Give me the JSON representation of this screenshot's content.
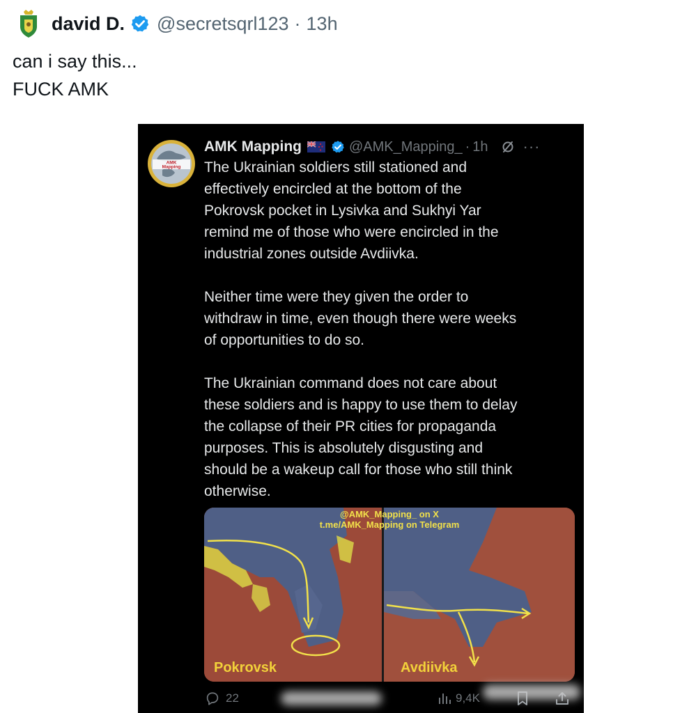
{
  "outer": {
    "author_name": "david D.",
    "handle": "@secretsqrl123",
    "separator": "·",
    "time": "13h",
    "text_lines": [
      "can i say this...",
      "FUCK AMK"
    ],
    "avatar_icon": "coat-of-arms-icon",
    "verified_icon": "verified-badge-icon",
    "verified_color": "#1d9bf0"
  },
  "embedded_post": {
    "author_name": "AMK Mapping",
    "flag_icon": "new-zealand-flag-icon",
    "handle": "@AMK_Mapping_",
    "separator": "·",
    "time": "1h",
    "grok_icon": "grok-icon",
    "more_icon": "more-options-icon",
    "more_glyph": "···",
    "avatar_text": [
      "AMK",
      "Mapping"
    ],
    "paragraphs": [
      [
        "The Ukrainian soldiers still stationed and",
        "effectively encircled at the bottom of the",
        "Pokrovsk pocket in Lysivka and Sukhyi Yar",
        "remind me of those who were encircled in the",
        "industrial zones outside Avdiivka."
      ],
      [
        "Neither time were they given the order to",
        "withdraw in time, even though there were weeks",
        "of opportunities to do so."
      ],
      [
        "The Ukrainian command does not care about",
        "these soldiers and is happy to use them to delay",
        "the collapse of their PR cities for propaganda",
        "purposes. This is absolutely disgusting and",
        "should be a wakeup call for those who still think",
        "otherwise."
      ]
    ],
    "media": {
      "caption_lines": [
        "@AMK_Mapping_ on X",
        "t.me/AMK_Mapping on Telegram"
      ],
      "left_label": "Pokrovsk",
      "right_label": "Avdiivka",
      "colors": {
        "terrain": "#9a4a3a",
        "controlled_area": "#4f5f86",
        "frontline_yellow": "#d9d447",
        "arrow": "#f2e14a"
      }
    },
    "actions": {
      "reply_count": "22",
      "views_count": "9,4K",
      "reply_icon": "reply-icon",
      "views_icon": "views-chart-icon",
      "bookmark_icon": "bookmark-icon",
      "share_icon": "share-icon"
    }
  }
}
